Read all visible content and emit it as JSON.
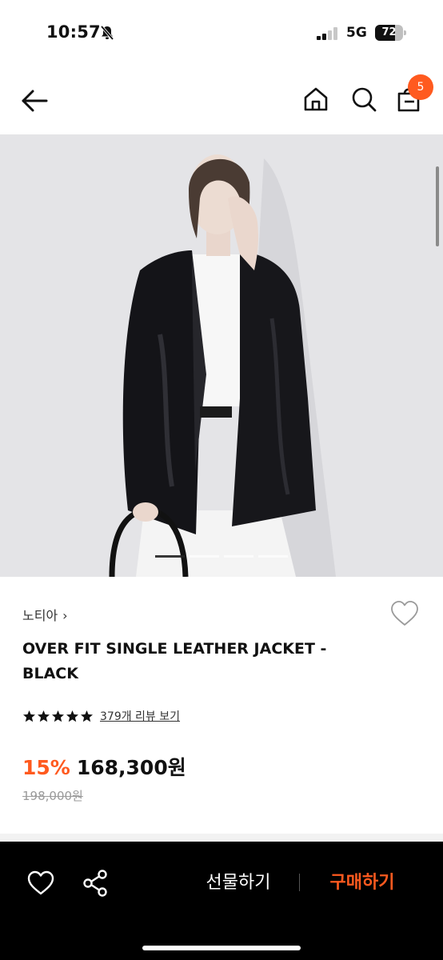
{
  "status_bar": {
    "time": "10:57",
    "network": "5G",
    "battery": "72",
    "battery_level": 0.72,
    "icons": [
      "bell-slash-icon",
      "signal-icon"
    ]
  },
  "header": {
    "cart_count": "5",
    "icons": [
      "back-arrow-icon",
      "home-icon",
      "search-icon",
      "cart-icon"
    ],
    "accent_color": "#ff5a1f"
  },
  "gallery": {
    "image_description_icon": "product-photo",
    "slide_count": 4,
    "active_slide": 1
  },
  "product": {
    "brand": "노티아",
    "brand_chevron": "›",
    "title": "OVER FIT SINGLE LEATHER JACKET - BLACK",
    "rating": 5,
    "review_link": "379개 리뷰 보기",
    "discount": "15%",
    "price": "168,300원",
    "original_price": "198,000원"
  },
  "bottom_bar": {
    "gift_label": "선물하기",
    "buy_label": "구매하기",
    "icons": [
      "heart-icon",
      "share-icon"
    ]
  }
}
